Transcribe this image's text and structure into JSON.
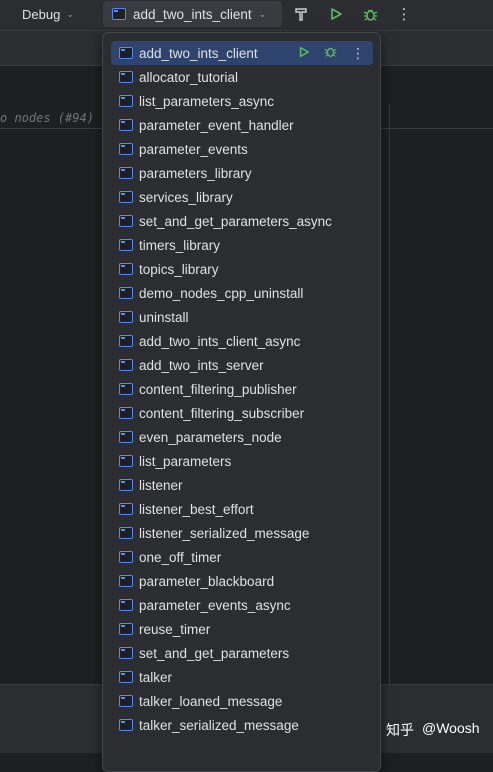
{
  "toolbar": {
    "debug_label": "Debug",
    "run_config_label": "add_two_ints_client",
    "build_icon": "hammer-icon",
    "run_icon": "run-icon",
    "debug_icon": "bug-icon",
    "more_icon": "more-vertical-icon"
  },
  "editor": {
    "inline_hint": "o nodes (#94)"
  },
  "popup": {
    "items": [
      {
        "label": "add_two_ints_client"
      },
      {
        "label": "allocator_tutorial"
      },
      {
        "label": "list_parameters_async"
      },
      {
        "label": "parameter_event_handler"
      },
      {
        "label": "parameter_events"
      },
      {
        "label": "parameters_library"
      },
      {
        "label": "services_library"
      },
      {
        "label": "set_and_get_parameters_async"
      },
      {
        "label": "timers_library"
      },
      {
        "label": "topics_library"
      },
      {
        "label": "demo_nodes_cpp_uninstall"
      },
      {
        "label": "uninstall"
      },
      {
        "label": "add_two_ints_client_async"
      },
      {
        "label": "add_two_ints_server"
      },
      {
        "label": "content_filtering_publisher"
      },
      {
        "label": "content_filtering_subscriber"
      },
      {
        "label": "even_parameters_node"
      },
      {
        "label": "list_parameters"
      },
      {
        "label": "listener"
      },
      {
        "label": "listener_best_effort"
      },
      {
        "label": "listener_serialized_message"
      },
      {
        "label": "one_off_timer"
      },
      {
        "label": "parameter_blackboard"
      },
      {
        "label": "parameter_events_async"
      },
      {
        "label": "reuse_timer"
      },
      {
        "label": "set_and_get_parameters"
      },
      {
        "label": "talker"
      },
      {
        "label": "talker_loaned_message"
      },
      {
        "label": "talker_serialized_message"
      }
    ]
  },
  "watermark": {
    "site": "知乎",
    "author": "@Woosh"
  },
  "colors": {
    "accent": "#548af7",
    "run_green": "#5fb865",
    "selection": "#2e436e",
    "background": "#1e1f22",
    "panel": "#2b2d30"
  }
}
